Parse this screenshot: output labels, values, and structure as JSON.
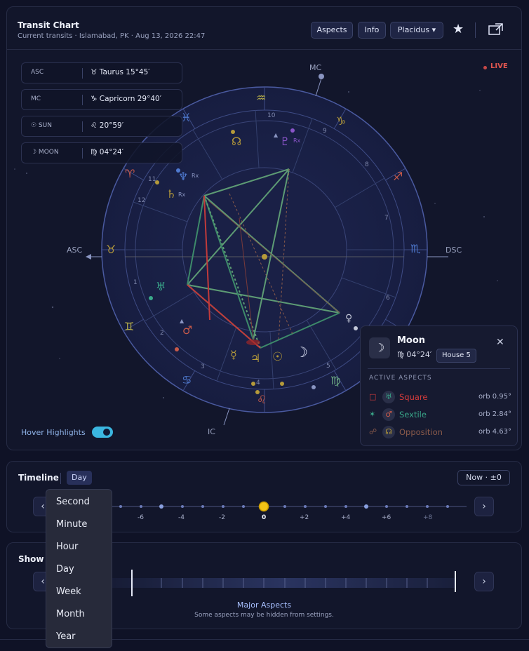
{
  "header": {
    "title": "Transit Chart",
    "subtitle": "Current transits · Islamabad, PK · Aug 13, 2026 22:47",
    "buttons": {
      "aspects": "Aspects",
      "info": "Info",
      "house_system": "Placidus ▾"
    },
    "icons": {
      "favorite": "star-icon",
      "popout": "external-window-icon"
    }
  },
  "info_rows": [
    {
      "key": "ASC",
      "glyph": "♉",
      "value": "Taurus  15°45′"
    },
    {
      "key": "MC",
      "glyph": "♑",
      "value": "Capricorn  29°40′"
    },
    {
      "key": "☉ SUN",
      "glyph": "♌",
      "value": "20°59′"
    },
    {
      "key": "☽ MOON",
      "glyph": "♍",
      "value": "04°24′"
    }
  ],
  "live": "LIVE",
  "wheel": {
    "axis": {
      "asc": "ASC",
      "dsc": "DSC",
      "mc": "MC",
      "ic": "IC"
    },
    "houses": [
      "1",
      "2",
      "3",
      "4",
      "5",
      "6",
      "7",
      "8",
      "9",
      "10",
      "11",
      "12"
    ],
    "retro": "Rx",
    "colors": {
      "fire": "#c85a4a",
      "earth": "#b59a3a",
      "air": "#b9b04a",
      "water": "#4f7ad0",
      "aspect_green": "#6fae86",
      "aspect_red": "#c23a3a"
    }
  },
  "hover_highlights": {
    "label": "Hover Highlights",
    "enabled": true
  },
  "popup": {
    "title": "Moon",
    "glyph": "☽",
    "position": "♍ 04°24′",
    "house": "House 5",
    "section": "ACTIVE ASPECTS",
    "aspects": [
      {
        "symbol": "□",
        "planet": "♅",
        "name": "Square",
        "orb": "orb 0.95°",
        "color": "#d23b3b"
      },
      {
        "symbol": "✶",
        "planet": "♂",
        "name": "Sextile",
        "orb": "orb 2.84°",
        "color": "#3aa88a"
      },
      {
        "symbol": "☍",
        "planet": "☊",
        "name": "Opposition",
        "orb": "orb 4.63°",
        "color": "#8a5a4a"
      }
    ]
  },
  "timeline": {
    "title": "Timeline",
    "unit": "Day",
    "now_button": "Now  ·  ±0",
    "ticks": [
      "-6",
      "-4",
      "-2",
      "0",
      "+2",
      "+4",
      "+6",
      "+8"
    ]
  },
  "aspects_section": {
    "title": "Show A",
    "main": "Major Aspects",
    "note": "Some aspects may be hidden from settings."
  },
  "dropdown": {
    "items": [
      "Second",
      "Minute",
      "Hour",
      "Day",
      "Week",
      "Month",
      "Year"
    ]
  }
}
